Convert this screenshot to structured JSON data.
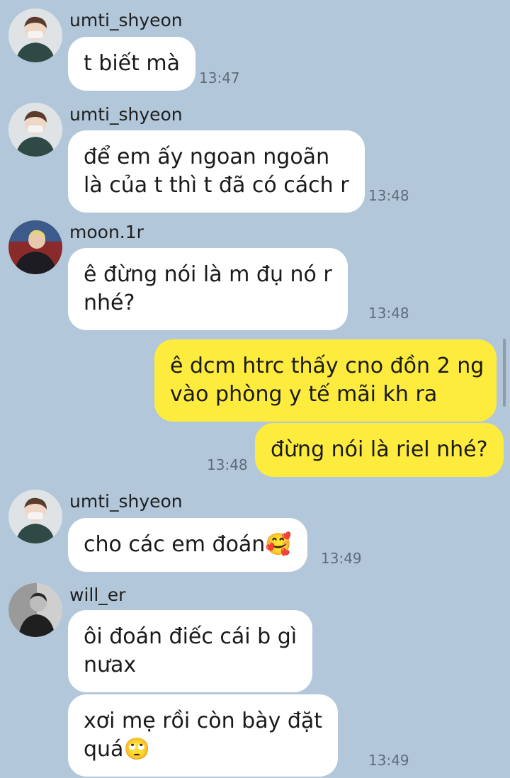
{
  "messages": [
    {
      "sender": "umti_shyeon",
      "lines": [
        "t biết mà"
      ],
      "time": "13:47"
    },
    {
      "sender": "umti_shyeon",
      "lines": [
        "để em ấy ngoan ngoãn",
        "là của t thì t đã có cách r"
      ],
      "time": "13:48"
    },
    {
      "sender": "moon.1r",
      "lines": [
        "ê đừng nói là m đụ nó r",
        "nhé?"
      ],
      "time": "13:48"
    },
    {
      "sender": "me",
      "lines": [
        "ê dcm htrc thấy cno đồn 2 ng",
        "vào phòng y tế mãi kh ra"
      ],
      "time": ""
    },
    {
      "sender": "me",
      "lines": [
        "đừng nói là riel nhé?"
      ],
      "time": "13:48"
    },
    {
      "sender": "umti_shyeon",
      "lines": [
        "cho các em đoán🥰"
      ],
      "time": "13:49"
    },
    {
      "sender": "will_er",
      "lines": [
        "ôi đoán điếc cái b gì",
        "nưax"
      ],
      "time": ""
    },
    {
      "sender": "will_er",
      "lines": [
        "xơi mẹ rồi còn bày đặt",
        "quá🙄"
      ],
      "time": "13:49"
    }
  ],
  "colors": {
    "background": "#b2c7da",
    "incoming_bubble": "#ffffff",
    "outgoing_bubble": "#fdeb3d",
    "timestamp": "#5f6d7a"
  }
}
